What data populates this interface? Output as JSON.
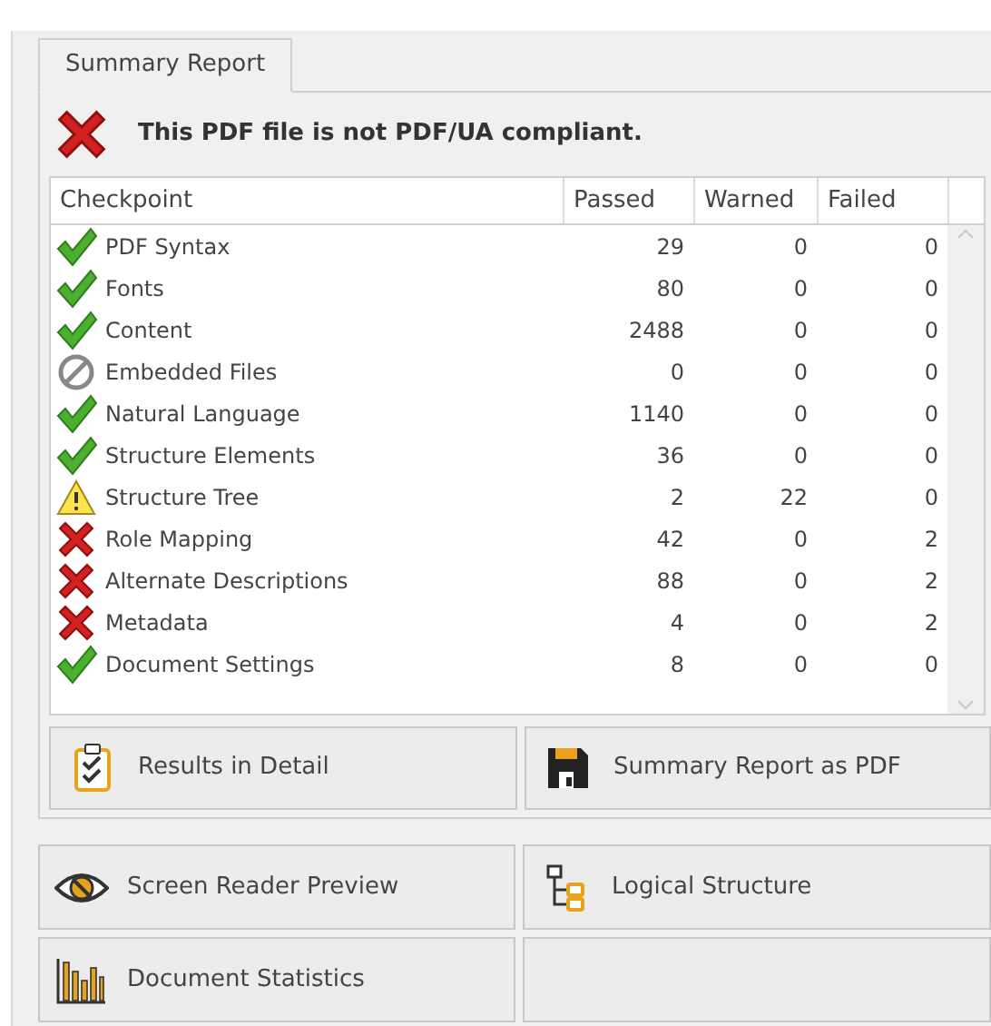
{
  "tabs": [
    {
      "label": "Summary Report",
      "selected": true
    }
  ],
  "verdict": {
    "kind": "fail",
    "message": "This PDF file is not PDF/UA compliant."
  },
  "table": {
    "columns": [
      "Checkpoint",
      "Passed",
      "Warned",
      "Failed"
    ],
    "rows": [
      {
        "kind": "pass",
        "checkpoint": "PDF Syntax",
        "passed": "29",
        "warned": "0",
        "failed": "0"
      },
      {
        "kind": "pass",
        "checkpoint": "Fonts",
        "passed": "80",
        "warned": "0",
        "failed": "0"
      },
      {
        "kind": "pass",
        "checkpoint": "Content",
        "passed": "2488",
        "warned": "0",
        "failed": "0"
      },
      {
        "kind": "skipped",
        "checkpoint": "Embedded Files",
        "passed": "0",
        "warned": "0",
        "failed": "0"
      },
      {
        "kind": "pass",
        "checkpoint": "Natural Language",
        "passed": "1140",
        "warned": "0",
        "failed": "0"
      },
      {
        "kind": "pass",
        "checkpoint": "Structure Elements",
        "passed": "36",
        "warned": "0",
        "failed": "0"
      },
      {
        "kind": "warning",
        "checkpoint": "Structure Tree",
        "passed": "2",
        "warned": "22",
        "failed": "0"
      },
      {
        "kind": "fail",
        "checkpoint": "Role Mapping",
        "passed": "42",
        "warned": "0",
        "failed": "2"
      },
      {
        "kind": "fail",
        "checkpoint": "Alternate Descriptions",
        "passed": "88",
        "warned": "0",
        "failed": "2"
      },
      {
        "kind": "fail",
        "checkpoint": "Metadata",
        "passed": "4",
        "warned": "0",
        "failed": "2"
      },
      {
        "kind": "pass",
        "checkpoint": "Document Settings",
        "passed": "8",
        "warned": "0",
        "failed": "0"
      }
    ]
  },
  "report_buttons": [
    {
      "label": "Results in Detail"
    },
    {
      "label": "Summary Report as PDF"
    }
  ],
  "tool_buttons": [
    {
      "label": "Screen Reader Preview"
    },
    {
      "label": "Logical Structure"
    },
    {
      "label": "Document Statistics"
    }
  ]
}
